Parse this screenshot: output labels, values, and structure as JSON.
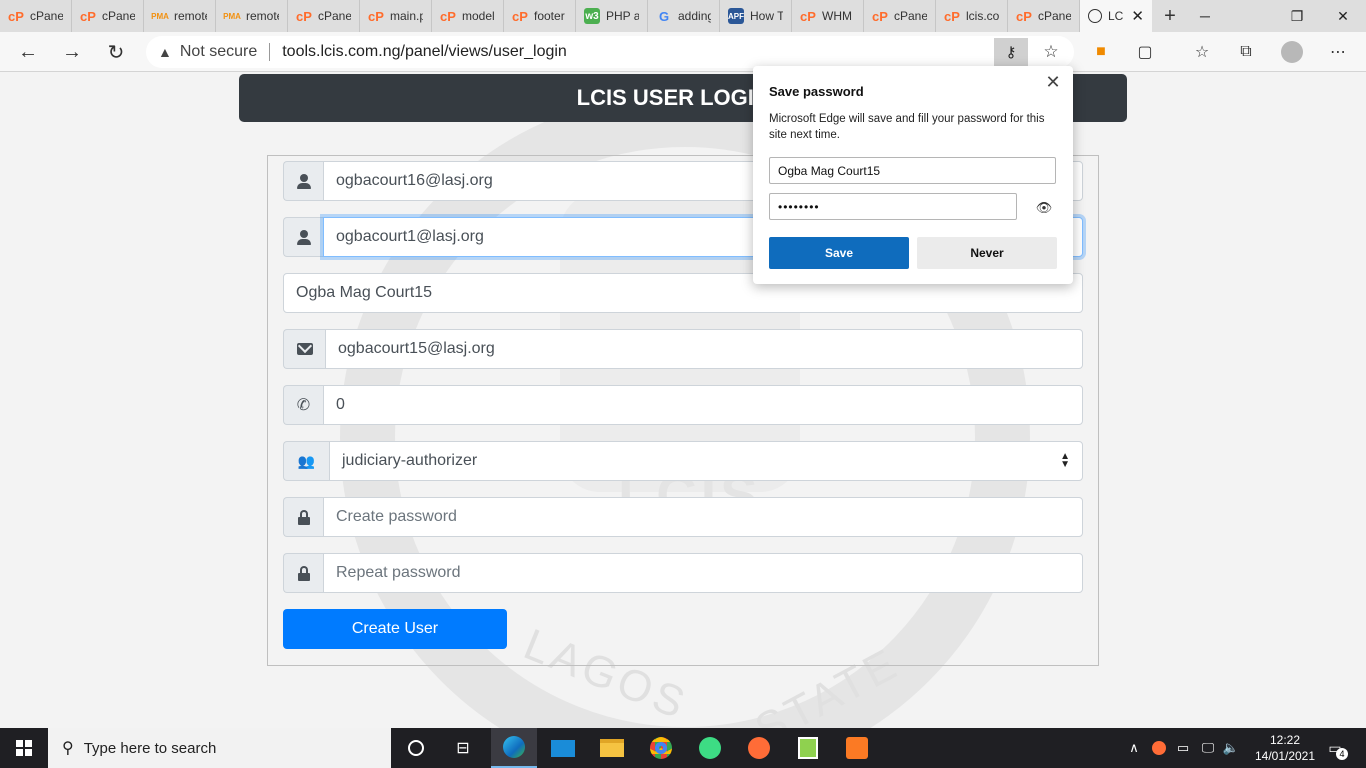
{
  "browser": {
    "tabs": [
      {
        "label": "cPanel",
        "icon": "cpanel-icon"
      },
      {
        "label": "cPanel",
        "icon": "cpanel-icon"
      },
      {
        "label": "remote",
        "icon": "phpmyadmin-icon"
      },
      {
        "label": "remote",
        "icon": "phpmyadmin-icon"
      },
      {
        "label": "cPanel",
        "icon": "cpanel-icon"
      },
      {
        "label": "main.p",
        "icon": "cpanel-icon"
      },
      {
        "label": "model",
        "icon": "cpanel-icon"
      },
      {
        "label": "footer",
        "icon": "cpanel-icon"
      },
      {
        "label": "PHP a",
        "icon": "w3schools-icon"
      },
      {
        "label": "adding",
        "icon": "google-icon"
      },
      {
        "label": "How T",
        "icon": "document-icon"
      },
      {
        "label": "WHM",
        "icon": "cpanel-icon"
      },
      {
        "label": "cPanel",
        "icon": "cpanel-icon"
      },
      {
        "label": "lcis.co",
        "icon": "cpanel-icon"
      },
      {
        "label": "cPanel",
        "icon": "cpanel-icon"
      },
      {
        "label": "LC",
        "icon": "globe-icon",
        "active": true
      }
    ],
    "pma_badge": "PMA",
    "w3_badge": "w3",
    "doc_badge": "APF",
    "google_glyph": "G",
    "cpanel_glyph": "cP",
    "address": {
      "security": "Not secure",
      "url": "tools.lcis.com.ng/panel/views/user_login"
    }
  },
  "page": {
    "header_title": "LCIS USER LOGIN F",
    "form": {
      "email_value": "ogbacourt16@lasj.org",
      "username_value": "ogbacourt1@lasj.org",
      "fullname_value": "Ogba Mag Court15",
      "email2_value": "ogbacourt15@lasj.org",
      "phone_value": "0",
      "role_value": "judiciary-authorizer",
      "password_placeholder": "Create password",
      "repeat_placeholder": "Repeat password",
      "submit_label": "Create User"
    },
    "watermark": {
      "lcis": "LCIS",
      "lagos": "LAGOS",
      "state": "STATE"
    }
  },
  "save_password_popup": {
    "title": "Save password",
    "description": "Microsoft Edge will save and fill your password for this site next time.",
    "username": "Ogba Mag Court15",
    "password_mask": "••••••••",
    "save_label": "Save",
    "never_label": "Never"
  },
  "taskbar": {
    "search_placeholder": "Type here to search",
    "time": "12:22",
    "date": "14/01/2021",
    "notification_count": "4"
  },
  "colors": {
    "header_bg": "#343a40",
    "primary": "#007bff",
    "edge_save": "#0f6cbd"
  }
}
